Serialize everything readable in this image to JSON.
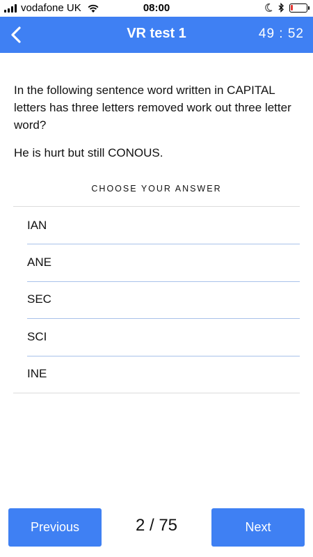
{
  "status_bar": {
    "carrier": "vodafone UK",
    "time": "08:00",
    "signal_bars": 4,
    "battery_level": 0.15,
    "battery_color": "#e53935"
  },
  "nav": {
    "back_icon": "chevron-left-icon",
    "title": "VR test 1",
    "timer": "49 : 52",
    "background": "#3f80f3"
  },
  "question": {
    "text": "In the following sentence word written in CAPITAL letters has three letters removed work out three letter word?",
    "sentence": "He is hurt but still CONOUS."
  },
  "choose_label": "CHOOSE YOUR ANSWER",
  "answers": [
    "IAN",
    "ANE",
    "SEC",
    "SCI",
    "INE"
  ],
  "footer": {
    "previous_label": "Previous",
    "next_label": "Next",
    "page_counter": "2 / 75"
  }
}
